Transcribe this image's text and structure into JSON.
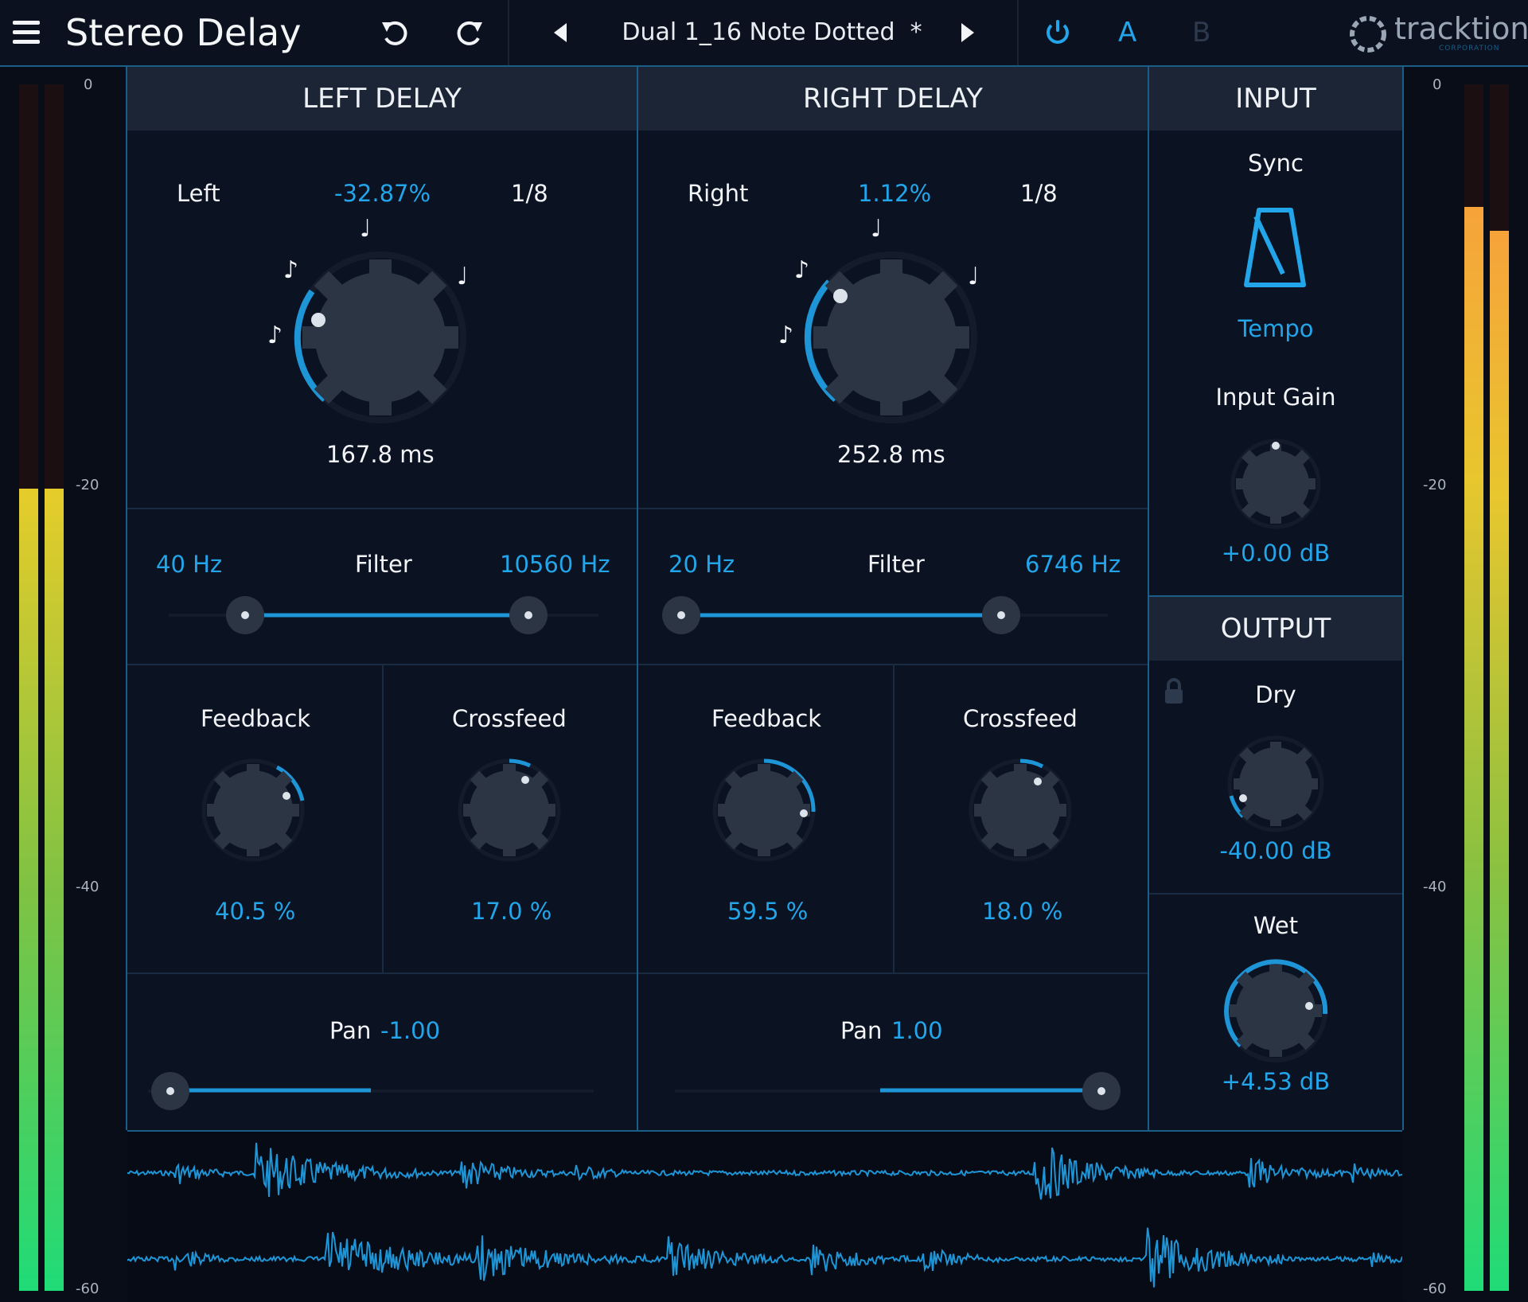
{
  "header": {
    "title": "Stereo Delay",
    "preset": "Dual 1_16 Note Dotted",
    "modified_mark": "*",
    "ab_a": "A",
    "ab_b": "B",
    "logo_text": "tracktion",
    "logo_sub": "CORPORATION"
  },
  "meters": {
    "scale": [
      "0",
      "-20",
      "-40",
      "-60"
    ],
    "left_level": [
      0.62,
      0.62
    ],
    "right_level": [
      0.91,
      0.89
    ]
  },
  "left_delay": {
    "title": "LEFT DELAY",
    "channel_label": "Left",
    "offset": "-32.87%",
    "division": "1/8",
    "time": "167.8 ms",
    "filter": {
      "label": "Filter",
      "low": "40 Hz",
      "high": "10560 Hz"
    },
    "feedback": {
      "label": "Feedback",
      "value": "40.5 %"
    },
    "crossfeed": {
      "label": "Crossfeed",
      "value": "17.0 %"
    },
    "pan": {
      "label": "Pan",
      "value": "-1.00"
    }
  },
  "right_delay": {
    "title": "RIGHT DELAY",
    "channel_label": "Right",
    "offset": "1.12%",
    "division": "1/8",
    "time": "252.8 ms",
    "filter": {
      "label": "Filter",
      "low": "20 Hz",
      "high": "6746 Hz"
    },
    "feedback": {
      "label": "Feedback",
      "value": "59.5 %"
    },
    "crossfeed": {
      "label": "Crossfeed",
      "value": "18.0 %"
    },
    "pan": {
      "label": "Pan",
      "value": "1.00"
    }
  },
  "input": {
    "title": "INPUT",
    "sync_label": "Sync",
    "sync_mode": "Tempo",
    "gain_label": "Input Gain",
    "gain_value": "+0.00 dB"
  },
  "output": {
    "title": "OUTPUT",
    "dry_label": "Dry",
    "dry_value": "-40.00 dB",
    "wet_label": "Wet",
    "wet_value": "+4.53 dB"
  },
  "colors": {
    "accent": "#23a5ea",
    "background": "#0b1222",
    "header": "#1b2535",
    "knob": "#2c3544"
  },
  "icons": {
    "menu": "hamburger-icon",
    "undo": "undo-icon",
    "redo": "redo-icon",
    "prev": "triangle-left-icon",
    "next": "triangle-right-icon",
    "power": "power-icon",
    "sync": "metronome-icon",
    "lock": "lock-icon"
  }
}
